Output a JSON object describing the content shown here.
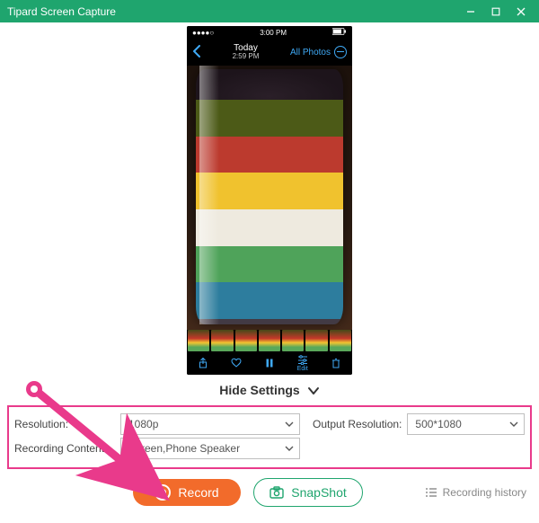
{
  "window": {
    "title": "Tipard Screen Capture"
  },
  "phone": {
    "status": {
      "carrier_signal": "●●●●○",
      "clock": "3:00 PM",
      "battery": "72%"
    },
    "header": {
      "today_label": "Today",
      "time_label": "2:59 PM",
      "all_photos_label": "All Photos"
    },
    "toolbar": {
      "share_label": "Share",
      "favorite_label": "Favorite",
      "pause_label": "Pause",
      "edit_label": "Edit",
      "delete_label": "Delete"
    },
    "mug_stripes": [
      "#4c5a17",
      "#bc3a2e",
      "#f0c22e",
      "#eeeadf",
      "#4fa35a",
      "#2d7d9e",
      "#423a44"
    ]
  },
  "hide_settings_label": "Hide Settings",
  "settings": {
    "resolution_label": "Resolution:",
    "resolution_value": "1080p",
    "output_label": "Output Resolution:",
    "output_value": "500*1080",
    "recording_content_label": "Recording Content:",
    "recording_content_value": "Screen,Phone Speaker"
  },
  "actions": {
    "record_label": "Record",
    "snapshot_label": "SnapShot",
    "history_label": "Recording history"
  }
}
